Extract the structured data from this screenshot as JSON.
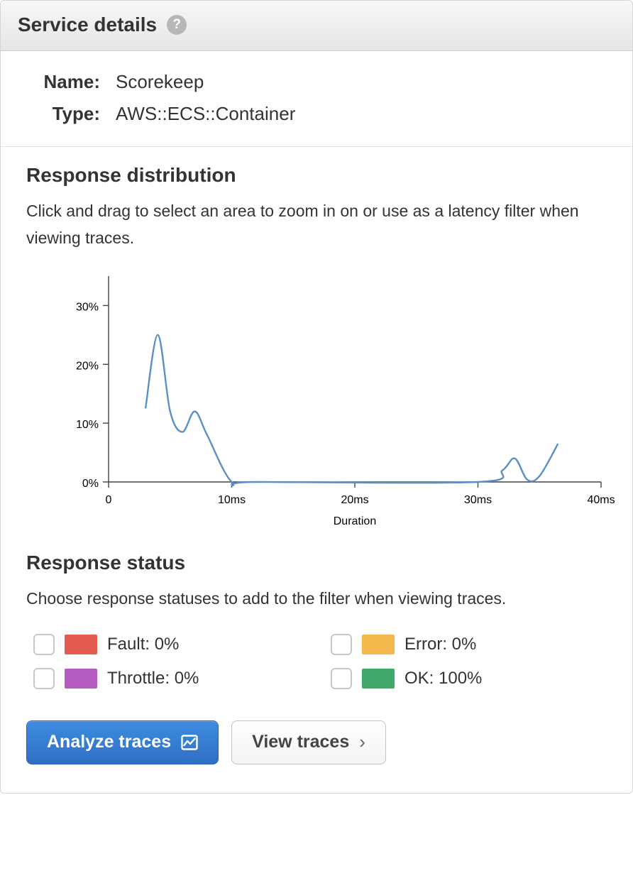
{
  "header": {
    "title": "Service details"
  },
  "meta": {
    "name_label": "Name:",
    "name_value": "Scorekeep",
    "type_label": "Type:",
    "type_value": "AWS::ECS::Container"
  },
  "response_distribution": {
    "title": "Response distribution",
    "desc": "Click and drag to select an area to zoom in on or use as a latency filter when viewing traces."
  },
  "response_status": {
    "title": "Response status",
    "desc": "Choose response statuses to add to the filter when viewing traces.",
    "items": [
      {
        "key": "fault",
        "label": "Fault: 0%",
        "color": "#e45b4f"
      },
      {
        "key": "error",
        "label": "Error: 0%",
        "color": "#f5b84d"
      },
      {
        "key": "throttle",
        "label": "Throttle: 0%",
        "color": "#b65cc0"
      },
      {
        "key": "ok",
        "label": "OK: 100%",
        "color": "#3fa86b"
      }
    ]
  },
  "buttons": {
    "analyze": "Analyze traces",
    "view": "View traces"
  },
  "chart_data": {
    "type": "line",
    "title": "",
    "xlabel": "Duration",
    "ylabel": "",
    "x_ticks": [
      "0",
      "10ms",
      "20ms",
      "30ms",
      "40ms"
    ],
    "y_ticks": [
      "0%",
      "10%",
      "20%",
      "30%"
    ],
    "xlim": [
      0,
      40
    ],
    "ylim": [
      0,
      35
    ],
    "series": [
      {
        "name": "distribution",
        "x": [
          3,
          4,
          5,
          6,
          7,
          8,
          10,
          12,
          30,
          32,
          33,
          34,
          35,
          36.5
        ],
        "y": [
          12.5,
          25,
          12,
          8.5,
          12,
          8,
          0,
          0,
          0,
          2,
          4,
          0.4,
          1,
          6.5
        ]
      }
    ]
  }
}
